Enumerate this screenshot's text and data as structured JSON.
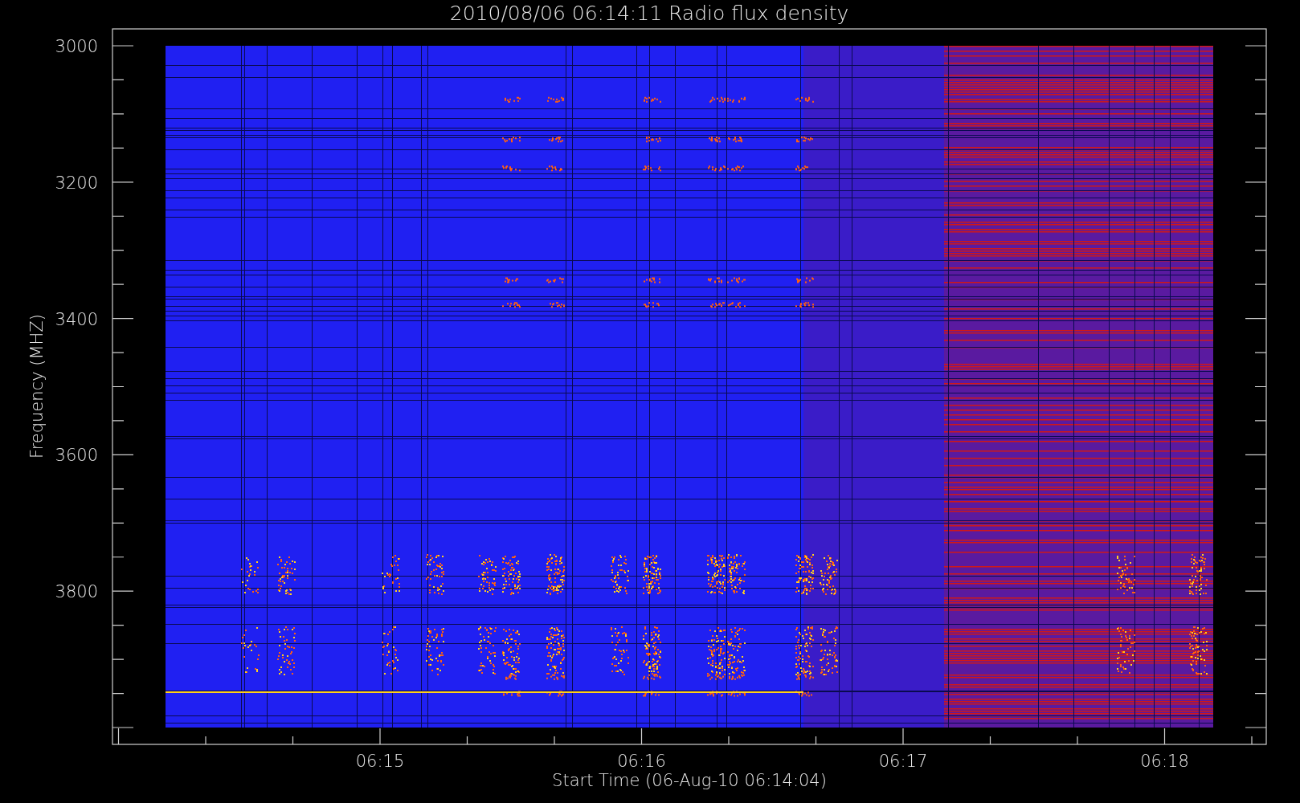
{
  "title": "2010/08/06 06:14:11 Radio flux density",
  "plot": {
    "ylabel": "Frequency (MHZ)",
    "xlabel": "Start Time (06-Aug-10 06:14:04)",
    "yticks": [
      "3000",
      "3200",
      "3400",
      "3600",
      "3800"
    ],
    "xticks": [
      "06:15",
      "06:16",
      "06:17",
      "06:18"
    ]
  }
}
